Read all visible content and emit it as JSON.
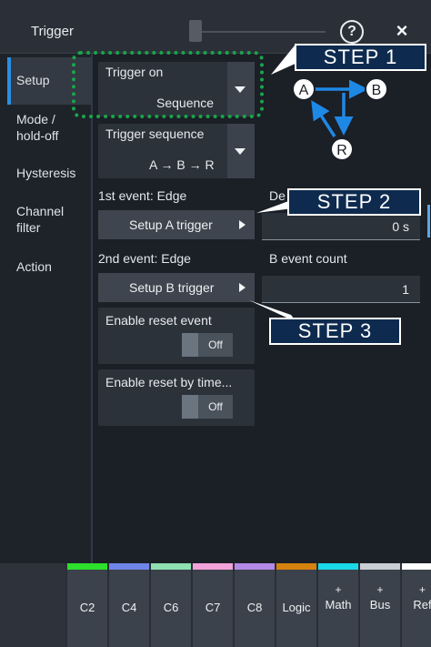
{
  "window": {
    "title": "Trigger",
    "help_label": "?",
    "close_label": "×"
  },
  "sidebar": {
    "items": [
      {
        "label": "Setup",
        "active": true
      },
      {
        "label": "Mode / hold-off"
      },
      {
        "label": "Hysteresis"
      },
      {
        "label": "Channel filter"
      },
      {
        "label": "Action"
      }
    ]
  },
  "trigger_on": {
    "label": "Trigger on",
    "value": "Sequence"
  },
  "trigger_sequence": {
    "label": "Trigger sequence",
    "value": "A → B → R"
  },
  "event1": {
    "label": "1st event: Edge",
    "button": "Setup A trigger"
  },
  "event2": {
    "label": "2nd event: Edge",
    "button": "Setup B trigger"
  },
  "delay": {
    "label": "De",
    "value": "0 s"
  },
  "b_event_count": {
    "label": "B event count",
    "value": "1"
  },
  "reset_event": {
    "label": "Enable reset event",
    "state": "Off"
  },
  "reset_timeout": {
    "label": "Enable reset by time...",
    "state": "Off"
  },
  "diagram": {
    "nodes": [
      "A",
      "B",
      "R"
    ]
  },
  "callouts": {
    "step1": "STEP 1",
    "step2": "STEP 2",
    "step3": "STEP 3"
  },
  "bottom_bar": {
    "items": [
      {
        "label": "C2",
        "color": "#2ce02c"
      },
      {
        "label": "C4",
        "color": "#6f86e8"
      },
      {
        "label": "C6",
        "color": "#8ee0b0"
      },
      {
        "label": "C7",
        "color": "#f2a2d8"
      },
      {
        "label": "C8",
        "color": "#b48ae8"
      },
      {
        "label": "Logic",
        "color": "#d6820e"
      },
      {
        "label": "Math",
        "prefix": "+",
        "color": "#19d8e8"
      },
      {
        "label": "Bus",
        "prefix": "+",
        "color": "#c9ced4"
      },
      {
        "label": "Ref",
        "prefix": "+",
        "color": "#ffffff"
      }
    ]
  }
}
